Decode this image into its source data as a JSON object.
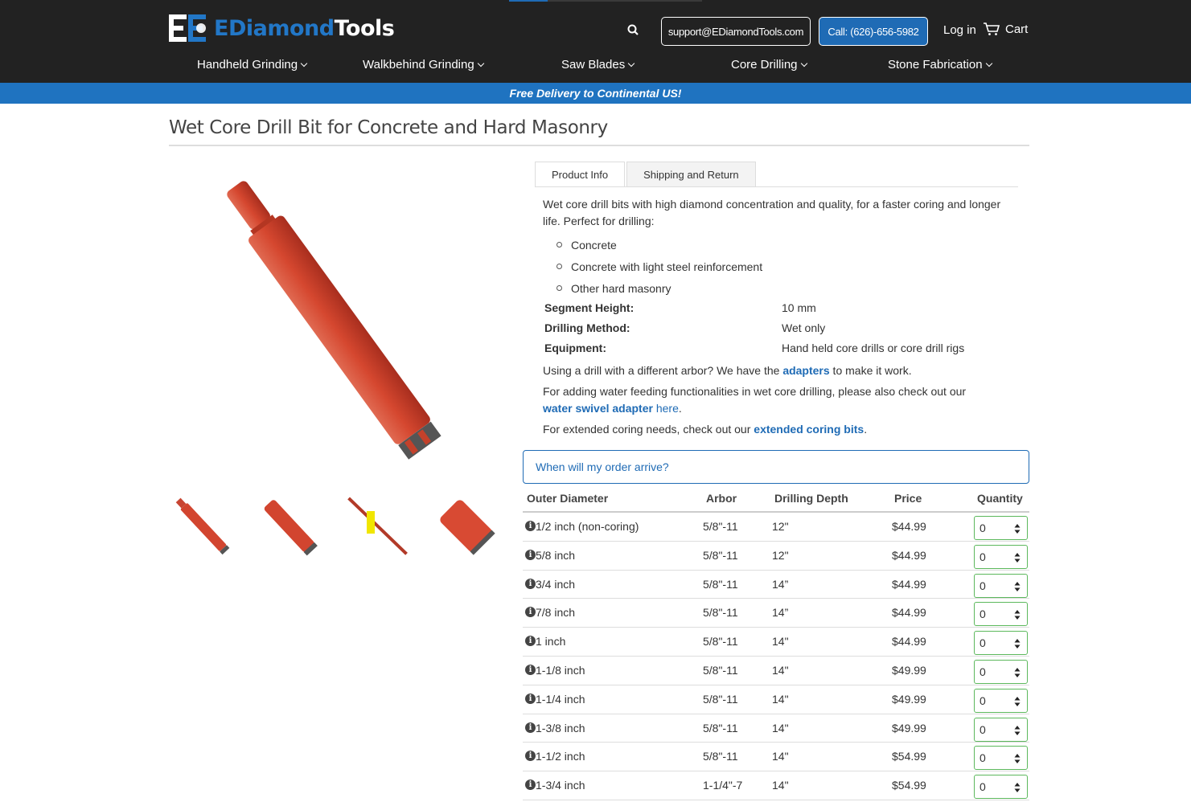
{
  "header": {
    "logo": {
      "text_a": "EDiamond",
      "text_b": "Tools"
    },
    "support_email": "support@EDiamondTools.com",
    "call_label": "Call: (626)-656-5982",
    "login_label": "Log in",
    "cart_label": "Cart"
  },
  "nav": [
    {
      "label": "Handheld Grinding"
    },
    {
      "label": "Walkbehind Grinding"
    },
    {
      "label": "Saw Blades"
    },
    {
      "label": "Core Drilling"
    },
    {
      "label": "Stone Fabrication"
    }
  ],
  "promo": "Free Delivery to Continental US!",
  "product": {
    "title": "Wet Core Drill Bit for Concrete and Hard Masonry",
    "tabs": [
      "Product Info",
      "Shipping and Return"
    ],
    "description": "Wet core drill bits with high diamond concentration and quality, for a faster coring and longer life. Perfect for drilling:",
    "uses": [
      "Concrete",
      "Concrete with light steel reinforcement",
      "Other hard masonry"
    ],
    "specs": [
      {
        "label": "Segment Height:",
        "value": "10 mm"
      },
      {
        "label": "Drilling Method:",
        "value": "Wet only"
      },
      {
        "label": "Equipment:",
        "value": "Hand held core drills or core drill rigs"
      }
    ],
    "para1_pre": "Using a drill with a different arbor? We have the ",
    "para1_link": "adapters",
    "para1_post": " to make it work.",
    "para2_pre": "For adding water feeding functionalities in wet core drilling, please also check out our ",
    "para2_link": "water swivel adapter",
    "para2_link2": " here",
    "para2_post": ".",
    "para3_pre": "For extended coring needs, check out our ",
    "para3_link": "extended coring bits",
    "para3_post": ".",
    "arrive_label": "When will my order arrive?"
  },
  "table": {
    "headers": [
      "Outer Diameter",
      "Arbor",
      "Drilling Depth",
      "Price",
      "Quantity"
    ],
    "rows": [
      {
        "diameter": "1/2 inch (non-coring)",
        "arbor": "5/8\"-11",
        "depth": "12\"",
        "price": "$44.99",
        "qty": "0"
      },
      {
        "diameter": "5/8 inch",
        "arbor": "5/8\"-11",
        "depth": "12\"",
        "price": "$44.99",
        "qty": "0"
      },
      {
        "diameter": "3/4 inch",
        "arbor": "5/8\"-11",
        "depth": "14”",
        "price": "$44.99",
        "qty": "0"
      },
      {
        "diameter": "7/8 inch",
        "arbor": "5/8\"-11",
        "depth": "14”",
        "price": "$44.99",
        "qty": "0"
      },
      {
        "diameter": "1 inch",
        "arbor": "5/8\"-11",
        "depth": "14\"",
        "price": "$44.99",
        "qty": "0"
      },
      {
        "diameter": "1-1/8 inch",
        "arbor": "5/8\"-11",
        "depth": "14\"",
        "price": "$49.99",
        "qty": "0"
      },
      {
        "diameter": "1-1/4 inch",
        "arbor": "5/8\"-11",
        "depth": "14\"",
        "price": "$49.99",
        "qty": "0"
      },
      {
        "diameter": "1-3/8 inch",
        "arbor": "5/8\"-11",
        "depth": "14\"",
        "price": "$49.99",
        "qty": "0"
      },
      {
        "diameter": "1-1/2 inch",
        "arbor": "5/8\"-11",
        "depth": "14\"",
        "price": "$54.99",
        "qty": "0"
      },
      {
        "diameter": "1-3/4 inch",
        "arbor": "1-1/4\"-7",
        "depth": "14\"",
        "price": "$54.99",
        "qty": "0"
      }
    ]
  },
  "colors": {
    "brand_blue": "#1f6bb5",
    "header_bg": "#222222",
    "product_red": "#d2452f"
  }
}
